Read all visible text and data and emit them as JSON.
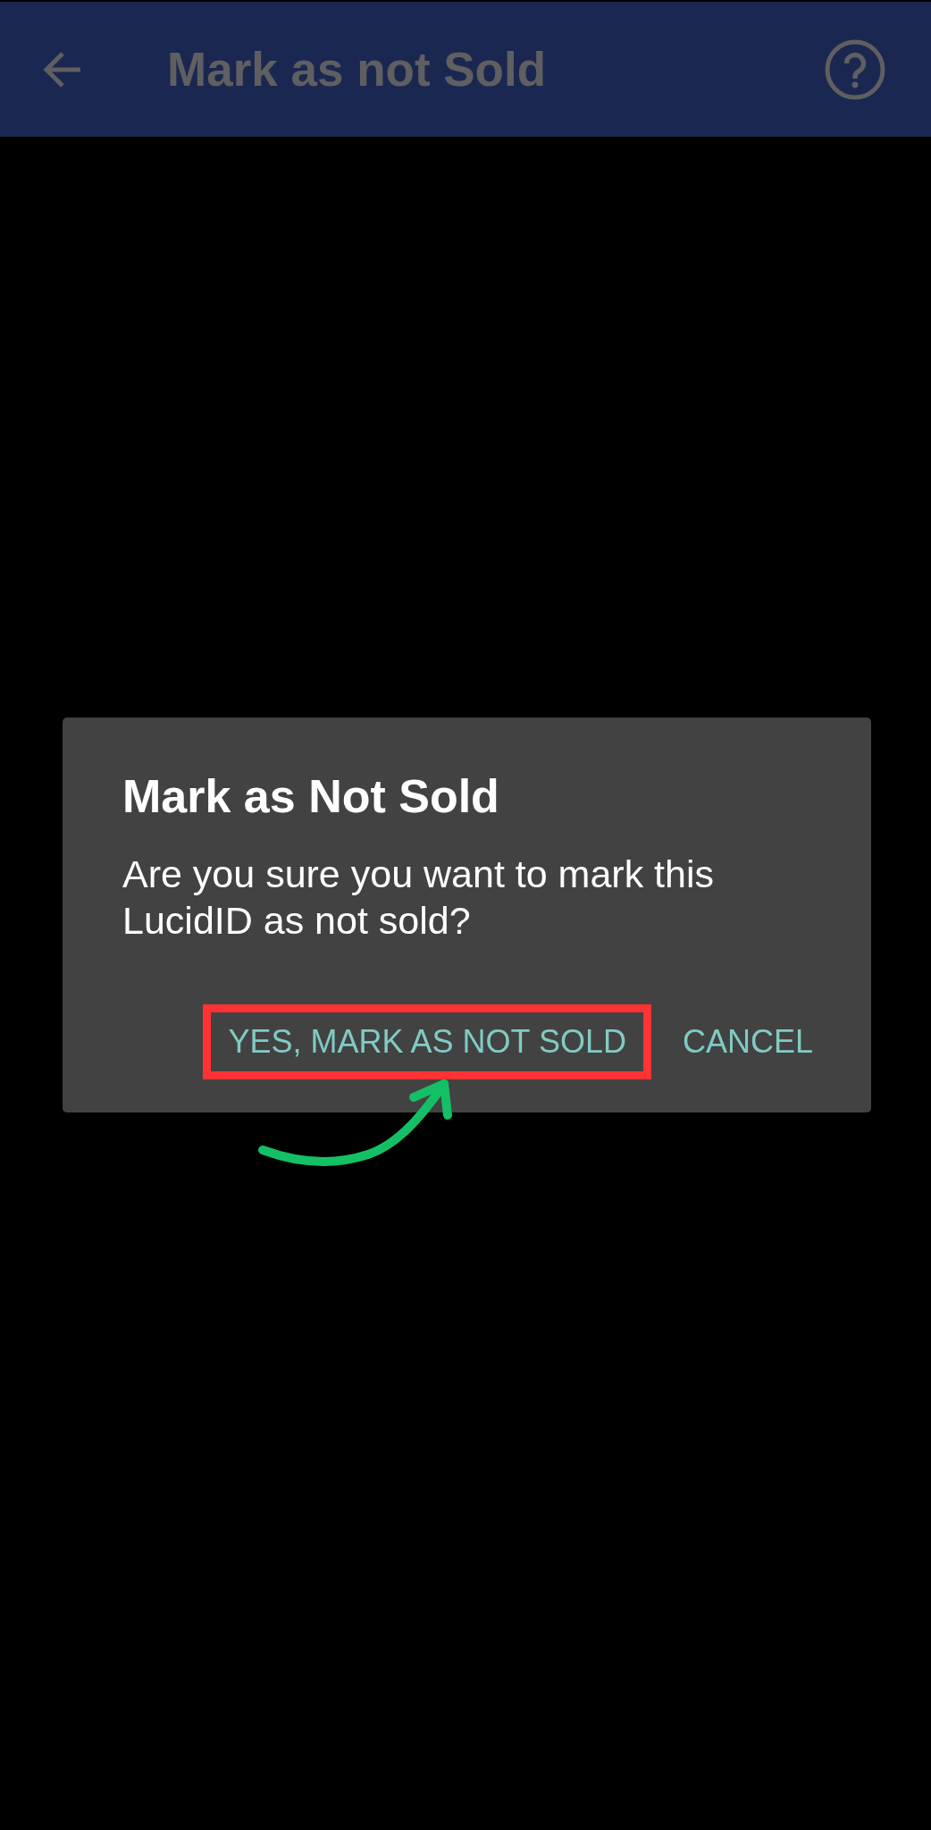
{
  "app_bar": {
    "title": "Mark as not Sold"
  },
  "dialog": {
    "title": "Mark as Not Sold",
    "message": "Are you sure you want to mark this LucidID as not sold?",
    "actions": [
      {
        "label": "YES, MARK AS NOT SOLD",
        "highlighted": true
      },
      {
        "label": "CANCEL",
        "highlighted": false
      }
    ]
  }
}
